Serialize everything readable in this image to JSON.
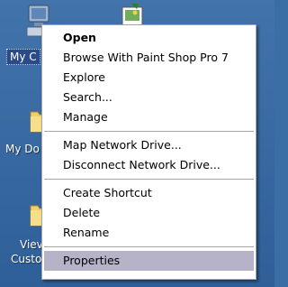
{
  "desktop": {
    "icons": [
      {
        "label": "My C",
        "icon": "my-computer-icon"
      },
      {
        "label": "My Do",
        "icon": "folder-icon"
      },
      {
        "label": "Viev",
        "icon": "folder-icon"
      },
      {
        "label": "Custo",
        "icon": "folder-icon"
      }
    ]
  },
  "context_menu": {
    "group1": [
      {
        "label": "Open"
      },
      {
        "label": "Browse With Paint Shop Pro 7"
      },
      {
        "label": "Explore"
      },
      {
        "label": "Search..."
      },
      {
        "label": "Manage"
      }
    ],
    "group2": [
      {
        "label": "Map Network Drive..."
      },
      {
        "label": "Disconnect Network Drive..."
      }
    ],
    "group3": [
      {
        "label": "Create Shortcut"
      },
      {
        "label": "Delete"
      },
      {
        "label": "Rename"
      }
    ],
    "group4": [
      {
        "label": "Properties"
      }
    ]
  },
  "colors": {
    "desktop": "#3b6ea5",
    "menu_bg": "#ffffff",
    "menu_highlight": "#b6b2c8",
    "separator": "#a7a6aa"
  }
}
